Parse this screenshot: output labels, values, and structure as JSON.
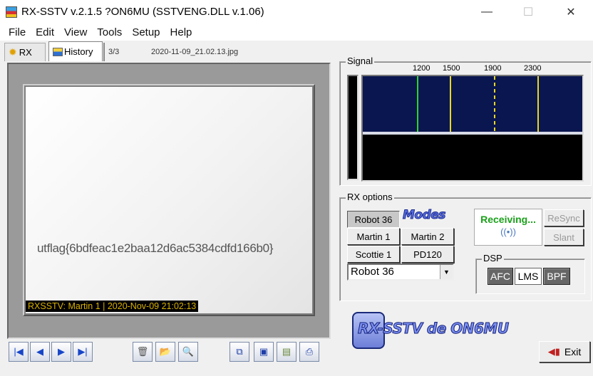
{
  "window": {
    "title": "RX-SSTV v.2.1.5 ?ON6MU (SSTVENG.DLL v.1.06)",
    "controls": {
      "minimize": "—",
      "maximize": "☐",
      "close": "✕"
    }
  },
  "menu": [
    "File",
    "Edit",
    "View",
    "Tools",
    "Setup",
    "Help"
  ],
  "tabs": {
    "rx_label": "RX",
    "history_label": "History",
    "count": "3/3",
    "filename": "2020-11-09_21.02.13.jpg"
  },
  "image": {
    "flag_text": "utflag{6bdfeac1e2baa12d6ac5384cdfd166b0}",
    "caption": "RXSSTV: Martin 1 | 2020-Nov-09 21:02:13"
  },
  "signal": {
    "label": "Signal",
    "freqs": [
      "1200",
      "1500",
      "1900",
      "2300"
    ],
    "colors": {
      "bg": "#0a1650",
      "green": "#2ad82a",
      "yellow": "#e8d820"
    }
  },
  "rx_options": {
    "label": "RX options",
    "modes_logo": "Modes",
    "buttons": {
      "robot36": "Robot 36",
      "martin1": "Martin 1",
      "martin2": "Martin 2",
      "scottie1": "Scottie 1",
      "pd120": "PD120"
    },
    "selected_mode": "Robot 36",
    "status": "Receiving...",
    "resync": "ReSync",
    "slant": "Slant",
    "dsp_label": "DSP",
    "dsp": {
      "afc": "AFC",
      "lms": "LMS",
      "bpf": "BPF"
    }
  },
  "footer": {
    "logo_text": "RX-SSTV de ON6MU",
    "exit": "Exit"
  },
  "icons": {
    "first": "first-icon",
    "prev": "prev-icon",
    "next": "next-icon",
    "last": "last-icon",
    "trash": "trash-icon",
    "folder": "folder-icon",
    "zoom": "zoom-icon",
    "copy": "copy-icon",
    "save": "save-icon",
    "save_as": "save-as-icon",
    "print": "print-icon"
  }
}
